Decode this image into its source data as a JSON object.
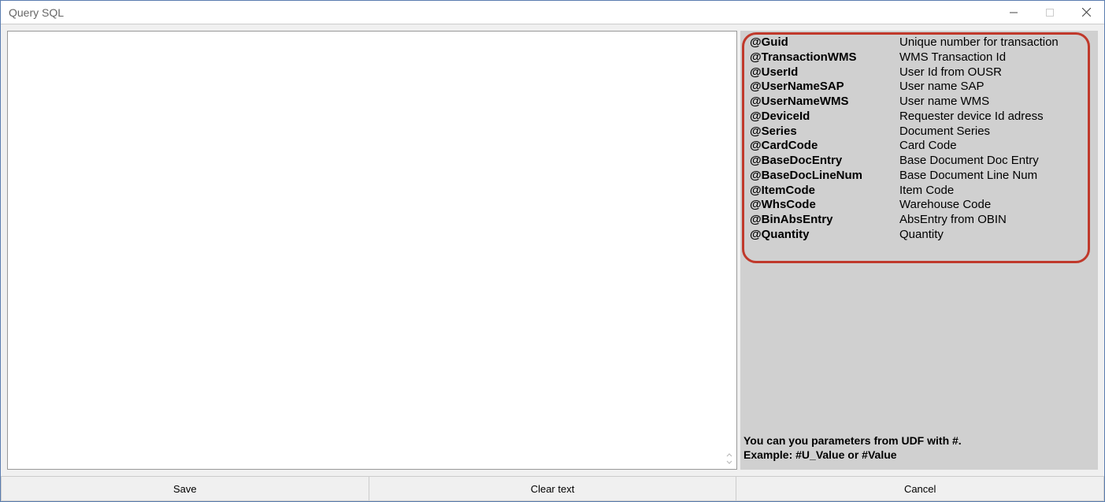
{
  "window": {
    "title": "Query SQL"
  },
  "query": {
    "value": ""
  },
  "params": [
    {
      "key": "@Guid",
      "desc": "Unique number for transaction"
    },
    {
      "key": "@TransactionWMS",
      "desc": "WMS Transaction Id"
    },
    {
      "key": "@UserId",
      "desc": "User Id from OUSR"
    },
    {
      "key": "@UserNameSAP",
      "desc": "User name SAP"
    },
    {
      "key": "@UserNameWMS",
      "desc": "User name WMS"
    },
    {
      "key": "@DeviceId",
      "desc": "Requester device Id adress"
    },
    {
      "key": "@Series",
      "desc": "Document Series"
    },
    {
      "key": "@CardCode",
      "desc": "Card Code"
    },
    {
      "key": "@BaseDocEntry",
      "desc": "Base Document Doc Entry"
    },
    {
      "key": "@BaseDocLineNum",
      "desc": "Base Document Line Num"
    },
    {
      "key": "@ItemCode",
      "desc": "Item Code"
    },
    {
      "key": "@WhsCode",
      "desc": "Warehouse Code"
    },
    {
      "key": "@BinAbsEntry",
      "desc": "AbsEntry from OBIN"
    },
    {
      "key": "@Quantity",
      "desc": "Quantity"
    }
  ],
  "udf_hint": {
    "line1": "You can you parameters from UDF with #.",
    "line2": "Example: #U_Value or #Value"
  },
  "buttons": {
    "save": "Save",
    "clear": "Clear text",
    "cancel": "Cancel"
  }
}
